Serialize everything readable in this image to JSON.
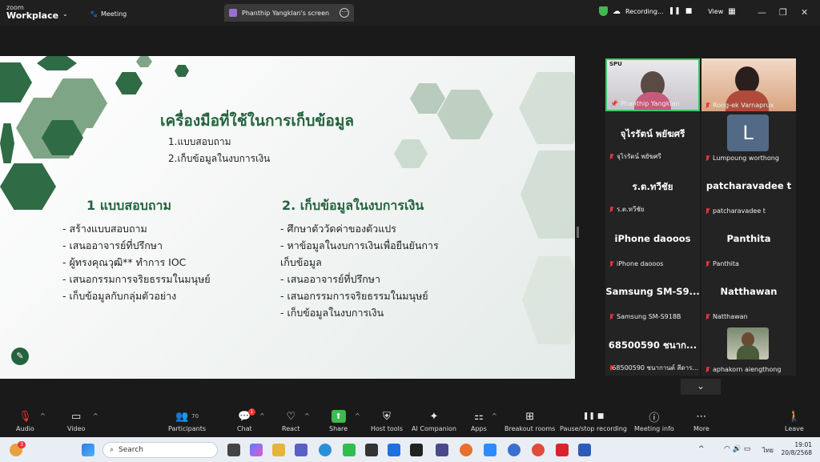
{
  "app": {
    "brand_top": "zoom",
    "brand_bottom": "Workplace",
    "meeting_label": "Meeting"
  },
  "share_tab": {
    "label": "Phanthip Yangklan's screen"
  },
  "recording": {
    "label": "Recording...",
    "view_label": "View"
  },
  "slide": {
    "title": "เครื่องมือที่ใช้ในการเก็บข้อมูล",
    "sub_items": [
      "1.แบบสอบถาม",
      "2.เก็บข้อมูลในงบการเงิน"
    ],
    "left_heading": "1 แบบสอบถาม",
    "left_items": [
      "- สร้างแบบสอบถาม",
      "- เสนออาจารย์ที่ปรึกษา",
      "- ผู้ทรงคุณวุฒิ** ทำการ IOC",
      "- เสนอกรรมการจริยธรรมในมนุษย์",
      "- เก็บข้อมูลกับกลุ่มตัวอย่าง"
    ],
    "right_heading": "2. เก็บข้อมูลในงบการเงิน",
    "right_items": [
      "- ศึกษาตัววัดค่าของตัวแปร",
      "- หาข้อมูลในงบการเงินเพื่อยืนยันการ",
      "เก็บข้อมูล",
      "- เสนออาจารย์ที่ปรึกษา",
      "- เสนอกรรมการจริยธรรมในมนุษย์",
      "- เก็บข้อมูลในงบการเงิน"
    ]
  },
  "participants": [
    {
      "big": "",
      "name": "Phanthip Yangklan",
      "overlay": "SPU"
    },
    {
      "big": "",
      "name": "Rong-ek Varnaprux"
    },
    {
      "big": "จุไรรัตน์ พยัฆศรี",
      "name": "จุไรรัตน์ พยัฆศรี"
    },
    {
      "big": "L",
      "name": "Lumpoung worthong"
    },
    {
      "big": "ร.ต.ทวีชัย",
      "name": "ร.ต.ทวีชัย"
    },
    {
      "big": "patcharavadee t",
      "name": "patcharavadee t"
    },
    {
      "big": "iPhone daooos",
      "name": "iPhone daooos"
    },
    {
      "big": "Panthita",
      "name": "Panthita"
    },
    {
      "big": "Samsung SM-S9...",
      "name": "Samsung SM-S918B"
    },
    {
      "big": "Natthawan",
      "name": "Natthawan"
    },
    {
      "big": "68500590 ชนาก...",
      "name": "68500590 ชนากานต์ สีดาร..."
    },
    {
      "big": "",
      "name": "aphakorn aiengthong"
    }
  ],
  "toolbar": {
    "audio": "Audio",
    "video": "Video",
    "participants": "Participants",
    "participants_count": "70",
    "chat": "Chat",
    "chat_badge": "1",
    "react": "React",
    "share": "Share",
    "host_tools": "Host tools",
    "ai_companion": "AI Companion",
    "apps": "Apps",
    "breakout": "Breakout rooms",
    "pause_rec": "Pause/stop recording",
    "meeting_info": "Meeting info",
    "more": "More",
    "leave": "Leave"
  },
  "taskbar": {
    "search_placeholder": "Search",
    "badge": "3",
    "lang": "ไทย",
    "time": "19:01",
    "date": "20/8/2568"
  },
  "colors": {
    "slide_green": "#24633e",
    "accent_green": "#3fc46b",
    "mute_red": "#e33333"
  }
}
